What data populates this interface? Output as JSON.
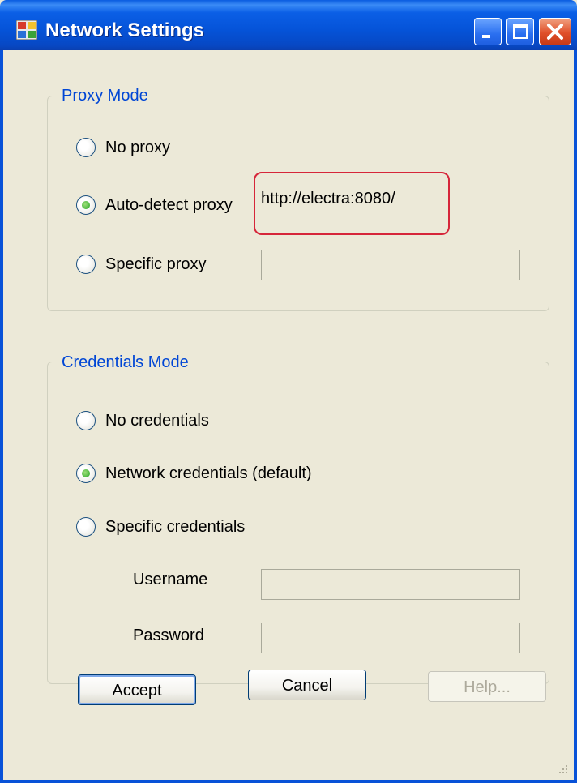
{
  "window": {
    "title": "Network Settings",
    "controls": {
      "minimize": "minimize",
      "maximize": "maximize",
      "close": "close"
    }
  },
  "proxy_mode": {
    "legend": "Proxy Mode",
    "options": [
      {
        "label": "No proxy",
        "selected": false
      },
      {
        "label": "Auto-detect proxy",
        "selected": true
      },
      {
        "label": "Specific proxy",
        "selected": false
      }
    ],
    "auto_detected_url": "http://electra:8080/",
    "specific_proxy_value": ""
  },
  "credentials_mode": {
    "legend": "Credentials Mode",
    "options": [
      {
        "label": "No credentials",
        "selected": false
      },
      {
        "label": "Network credentials (default)",
        "selected": true
      },
      {
        "label": "Specific credentials",
        "selected": false
      }
    ],
    "username_label": "Username",
    "username_value": "",
    "password_label": "Password",
    "password_value": ""
  },
  "buttons": {
    "accept": "Accept",
    "cancel": "Cancel",
    "help": "Help..."
  },
  "colors": {
    "titlebar": "#0553d8",
    "legend_text": "#0046d5",
    "highlight_border": "#d6263a",
    "radio_selected": "#21a121"
  }
}
